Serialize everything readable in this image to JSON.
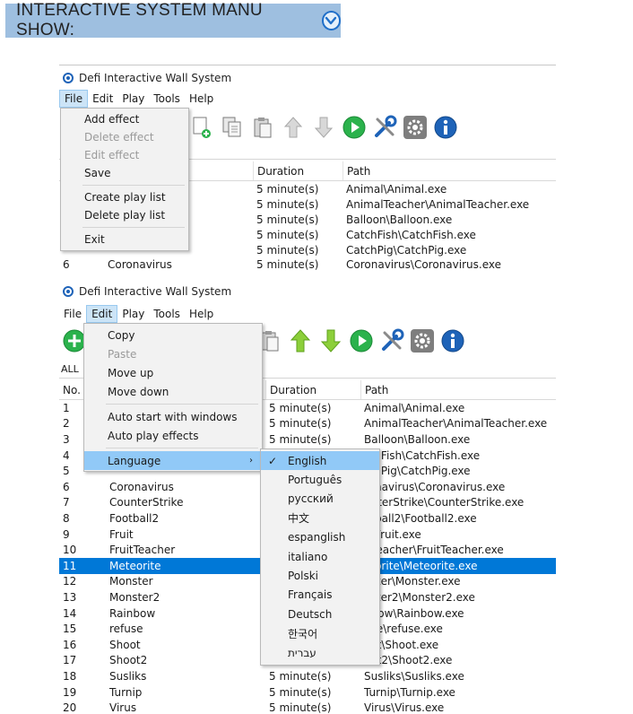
{
  "banner": {
    "title": "INTERACTIVE SYSTEM MANU SHOW:",
    "icon": "chevron-down-icon"
  },
  "window1": {
    "title": "Defi Interactive Wall System",
    "menu": [
      "File",
      "Edit",
      "Play",
      "Tools",
      "Help"
    ],
    "columns": {
      "duration": "Duration",
      "path": "Path"
    },
    "rows": [
      {
        "no": "",
        "name": "",
        "duration": "5 minute(s)",
        "path": "Animal\\Animal.exe"
      },
      {
        "no": "",
        "name": "",
        "duration": "5 minute(s)",
        "path": "AnimalTeacher\\AnimalTeacher.exe"
      },
      {
        "no": "",
        "name": "",
        "duration": "5 minute(s)",
        "path": "Balloon\\Balloon.exe"
      },
      {
        "no": "",
        "name": "",
        "duration": "5 minute(s)",
        "path": "CatchFish\\CatchFish.exe"
      },
      {
        "no": "",
        "name": "",
        "duration": "5 minute(s)",
        "path": "CatchPig\\CatchPig.exe"
      },
      {
        "no": "6",
        "name": "Coronavirus",
        "duration": "5 minute(s)",
        "path": "Coronavirus\\Coronavirus.exe"
      }
    ],
    "file_menu": [
      {
        "label": "Add effect",
        "disabled": false
      },
      {
        "label": "Delete effect",
        "disabled": true
      },
      {
        "label": "Edit effect",
        "disabled": true
      },
      {
        "label": "Save",
        "disabled": false
      },
      {
        "label": "Create play list",
        "disabled": false
      },
      {
        "label": "Delete play list",
        "disabled": false
      },
      {
        "label": "Exit",
        "disabled": false
      }
    ]
  },
  "window2": {
    "title": "Defi Interactive Wall System",
    "menu": [
      "File",
      "Edit",
      "Play",
      "Tools",
      "Help"
    ],
    "all_label": "ALL",
    "columns": {
      "no": "No.",
      "duration": "Duration",
      "path": "Path"
    },
    "rows": [
      {
        "no": "1",
        "name": "",
        "duration": "5 minute(s)",
        "path": "Animal\\Animal.exe"
      },
      {
        "no": "2",
        "name": "",
        "duration": "5 minute(s)",
        "path": "AnimalTeacher\\AnimalTeacher.exe"
      },
      {
        "no": "3",
        "name": "",
        "duration": "5 minute(s)",
        "path": "Balloon\\Balloon.exe"
      },
      {
        "no": "4",
        "name": "",
        "duration": "",
        "path": "tchFish\\CatchFish.exe"
      },
      {
        "no": "5",
        "name": "",
        "duration": "",
        "path": "tchPig\\CatchPig.exe"
      },
      {
        "no": "6",
        "name": "Coronavirus",
        "duration": "",
        "path": "ronavirus\\Coronavirus.exe"
      },
      {
        "no": "7",
        "name": "CounterStrike",
        "duration": "",
        "path": "unterStrike\\CounterStrike.exe"
      },
      {
        "no": "8",
        "name": "Football2",
        "duration": "",
        "path": "otball2\\Football2.exe"
      },
      {
        "no": "9",
        "name": "Fruit",
        "duration": "",
        "path": "it\\Fruit.exe"
      },
      {
        "no": "10",
        "name": "FruitTeacher",
        "duration": "",
        "path": "itTeacher\\FruitTeacher.exe"
      },
      {
        "no": "11",
        "name": "Meteorite",
        "duration": "",
        "path": "teorite\\Meteorite.exe"
      },
      {
        "no": "12",
        "name": "Monster",
        "duration": "",
        "path": "nster\\Monster.exe"
      },
      {
        "no": "13",
        "name": "Monster2",
        "duration": "",
        "path": "nster2\\Monster2.exe"
      },
      {
        "no": "14",
        "name": "Rainbow",
        "duration": "",
        "path": "nbow\\Rainbow.exe"
      },
      {
        "no": "15",
        "name": "refuse",
        "duration": "",
        "path": "use\\refuse.exe"
      },
      {
        "no": "16",
        "name": "Shoot",
        "duration": "",
        "path": "oot\\Shoot.exe"
      },
      {
        "no": "17",
        "name": "Shoot2",
        "duration": "",
        "path": "oot2\\Shoot2.exe"
      },
      {
        "no": "18",
        "name": "Susliks",
        "duration": "5 minute(s)",
        "path": "Susliks\\Susliks.exe"
      },
      {
        "no": "19",
        "name": "Turnip",
        "duration": "5 minute(s)",
        "path": "Turnip\\Turnip.exe"
      },
      {
        "no": "20",
        "name": "Virus",
        "duration": "5 minute(s)",
        "path": "Virus\\Virus.exe"
      }
    ],
    "selected_row": 10,
    "edit_menu": [
      {
        "label": "Copy",
        "disabled": false
      },
      {
        "label": "Paste",
        "disabled": true
      },
      {
        "label": "Move up",
        "disabled": false
      },
      {
        "label": "Move down",
        "disabled": false
      },
      {
        "label": "Auto start with windows",
        "disabled": false
      },
      {
        "label": "Auto play effects",
        "disabled": false
      },
      {
        "label": "Language",
        "disabled": false
      }
    ],
    "languages": [
      "English",
      "Português",
      "русский",
      "中文",
      "espanglish",
      "italiano",
      "Polski",
      "Français",
      "Deutsch",
      "한국어",
      "עברית"
    ],
    "selected_language": "English",
    "check_mark": "✓",
    "submenu_arrow": "›"
  },
  "toolbar_icons": [
    "add-icon",
    "copy-icon",
    "paste-icon",
    "move-up-icon",
    "move-down-icon",
    "play-icon",
    "tools-icon",
    "settings-icon",
    "info-icon"
  ],
  "colors": {
    "selection": "#0078d7",
    "menu_highlight": "#91c9f7",
    "banner": "#9ebfe0",
    "green": "#2bb24c",
    "blue": "#1e63b8"
  }
}
